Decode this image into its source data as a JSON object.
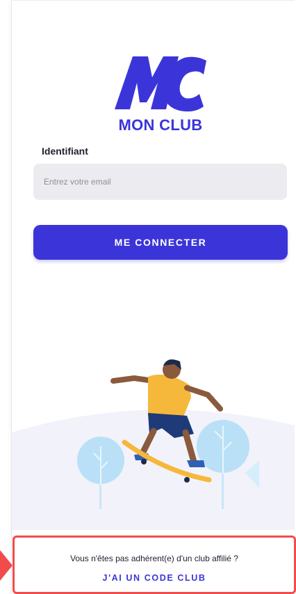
{
  "brand": {
    "logo_text": "MON CLUB",
    "primary_color": "#3b35d9"
  },
  "login_form": {
    "identifier_label": "Identifiant",
    "email_placeholder": "Entrez votre email",
    "email_value": "",
    "submit_label": "ME CONNECTER"
  },
  "illustration": {
    "icon": "skateboarder-illustration"
  },
  "footer": {
    "not_member_text": "Vous n'êtes pas adhérent(e) d'un club affilié ?",
    "code_link_label": "J'AI UN CODE CLUB",
    "highlight_color": "#f24b4b"
  }
}
